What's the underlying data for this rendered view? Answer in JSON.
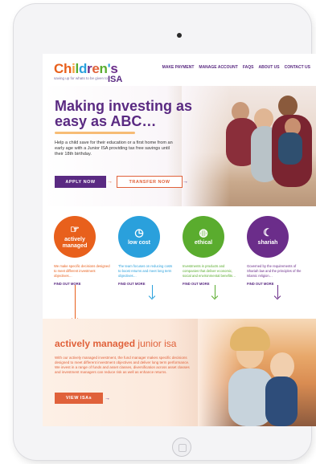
{
  "header": {
    "logo_main": "Children's",
    "logo_isa": "ISA",
    "logo_tagline": "saving up for whats to be given to",
    "nav": [
      "MAKE PAYMENT",
      "MANAGE ACCOUNT",
      "FAQS",
      "ABOUT US",
      "CONTACT US"
    ]
  },
  "hero": {
    "title": "Making investing as easy as ABC…",
    "body": "Help a child save for their education or a first home from an early age with a Junior ISA providing tax free savings until their 18th birthday.",
    "apply_label": "APPLY NOW",
    "transfer_label": "TRANSFER NOW"
  },
  "products": [
    {
      "title": "actively managed",
      "icon": "hand-pointer-icon",
      "color": "#e8601c",
      "text": "We make specific decisions designed to meet different investment objectives…",
      "more": "FIND OUT MORE"
    },
    {
      "title": "low cost",
      "icon": "piggy-bank-icon",
      "color": "#2aa0dc",
      "text": "The team focuses on reducing costs to boost returns and meet long term objectives…",
      "more": "FIND OUT MORE"
    },
    {
      "title": "ethical",
      "icon": "globe-icon",
      "color": "#5aac2e",
      "text": "Investments in products and companies that deliver economic, social and environmental benefits…",
      "more": "FIND OUT MORE"
    },
    {
      "title": "shariah",
      "icon": "crescent-star-icon",
      "color": "#6b2d8a",
      "text": "Governed by the requirements of Shariah law and the principles of the Islamic religion…",
      "more": "FIND OUT MORE"
    }
  ],
  "feature": {
    "title_bold": "actively managed",
    "title_rest": " junior isa",
    "body": "With our actively managed investment, the fund manager makes specific decisions designed to meet different investment objectives and deliver long term performance. We invest in a range of funds and asset classes, diversification across asset classes and investment managers can reduce risk as well as enhance returns.",
    "button": "VIEW ISAs"
  },
  "colors": {
    "purple": "#5a2a82",
    "orange": "#e0613a"
  }
}
